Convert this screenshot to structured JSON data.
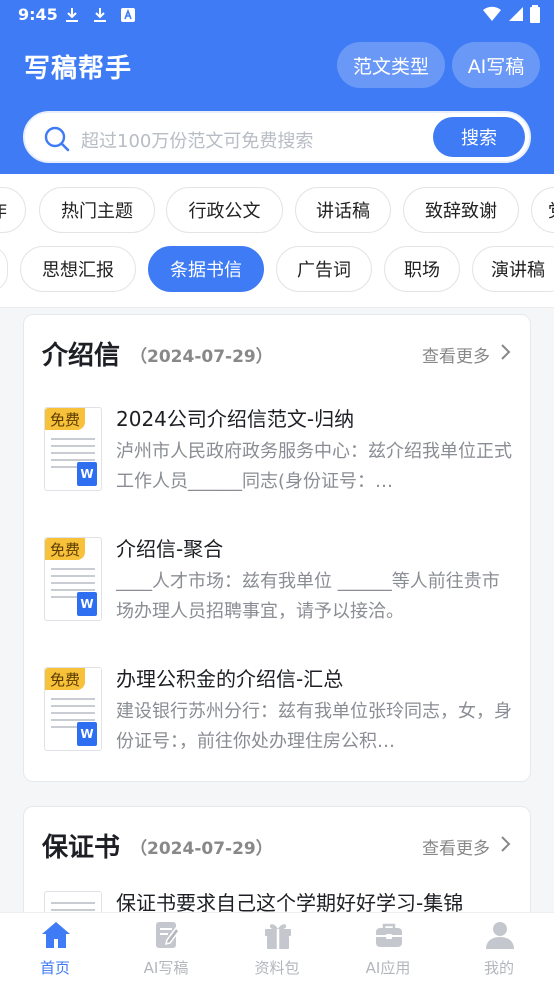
{
  "status_bar": {
    "time": "9:45"
  },
  "header": {
    "title": "写稿帮手",
    "btn_types": "范文类型",
    "btn_ai": "AI写稿"
  },
  "search": {
    "placeholder": "超过100万份范文可免费搜索",
    "button": "搜索"
  },
  "chips_row1": [
    "作",
    "热门主题",
    "行政公文",
    "讲话稿",
    "致辞致谢",
    "党"
  ],
  "chips_row2": [
    "",
    "思想汇报",
    "条据书信",
    "广告词",
    "职场",
    "演讲稿"
  ],
  "active_chip": "条据书信",
  "sections": [
    {
      "title": "介绍信",
      "date": "（2024-07-29）",
      "more": "查看更多",
      "items": [
        {
          "tag": "免费",
          "title": "2024公司介绍信范文-归纳",
          "desc": "泸州市人民政府政务服务中心：兹介绍我单位正式工作人员______同志(身份证号：…"
        },
        {
          "tag": "免费",
          "title": "介绍信-聚合",
          "desc": "____人才市场：兹有我单位 ______等人前往贵市场办理人员招聘事宜，请予以接洽。"
        },
        {
          "tag": "免费",
          "title": "办理公积金的介绍信-汇总",
          "desc": "建设银行苏州分行：兹有我单位张玲同志，女，身份证号：，前往你处办理住房公积…"
        }
      ]
    },
    {
      "title": "保证书",
      "date": "（2024-07-29）",
      "more": "查看更多",
      "items": [
        {
          "title": "保证书要求自己这个学期好好学习-集锦"
        }
      ]
    }
  ],
  "tabbar": [
    {
      "label": "首页",
      "icon": "home-icon",
      "active": true
    },
    {
      "label": "AI写稿",
      "icon": "edit-icon"
    },
    {
      "label": "资料包",
      "icon": "gift-icon"
    },
    {
      "label": "AI应用",
      "icon": "briefcase-icon"
    },
    {
      "label": "我的",
      "icon": "user-icon"
    }
  ],
  "colors": {
    "primary": "#3f7bf5",
    "free_tag": "#f7c23a"
  }
}
